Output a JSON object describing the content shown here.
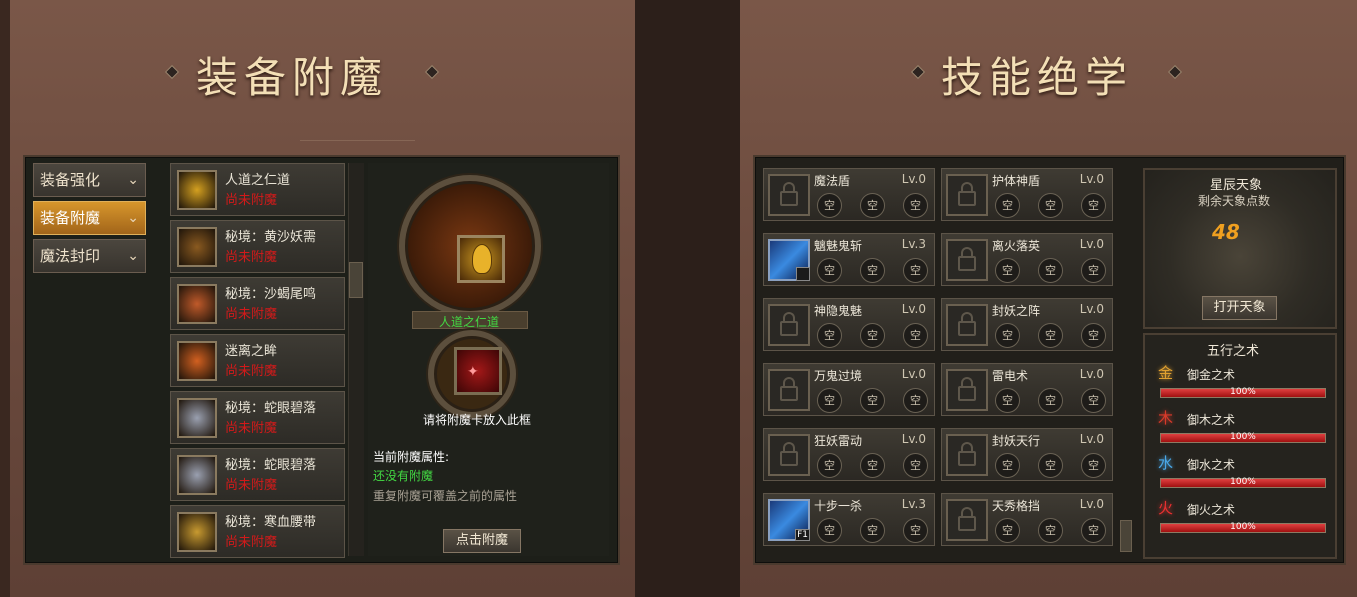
{
  "left_panel": {
    "title": "装备附魔",
    "tabs": [
      {
        "label": "装备强化",
        "active": false
      },
      {
        "label": "装备附魔",
        "active": true
      },
      {
        "label": "魔法封印",
        "active": false
      }
    ],
    "items": [
      {
        "name": "人道之仁道",
        "status": "尚未附魔"
      },
      {
        "name": "秘境：黄沙妖需",
        "status": "尚未附魔"
      },
      {
        "name": "秘境：沙蝎尾鸣",
        "status": "尚未附魔"
      },
      {
        "name": "迷离之眸",
        "status": "尚未附魔"
      },
      {
        "name": "秘境：蛇眼碧落",
        "status": "尚未附魔"
      },
      {
        "name": "秘境：蛇眼碧落",
        "status": "尚未附魔"
      },
      {
        "name": "秘境：寒血腰带",
        "status": "尚未附魔"
      }
    ],
    "enchant": {
      "selected_item": "人道之仁道",
      "slot_hint": "请将附魔卡放入此框",
      "attr_label": "当前附魔属性:",
      "attr_value": "还没有附魔",
      "attr_note": "重复附魔可覆盖之前的属性",
      "button": "点击附魔"
    }
  },
  "right_panel": {
    "title": "技能绝学",
    "empty_label": "空",
    "skills": [
      {
        "name": "魔法盾",
        "level": "Lv.0",
        "locked": true
      },
      {
        "name": "护体神盾",
        "level": "Lv.0",
        "locked": true
      },
      {
        "name": "魑魅鬼斩",
        "level": "Lv.3",
        "locked": false
      },
      {
        "name": "离火落英",
        "level": "Lv.0",
        "locked": true
      },
      {
        "name": "神隐鬼魅",
        "level": "Lv.0",
        "locked": true
      },
      {
        "name": "封妖之阵",
        "level": "Lv.0",
        "locked": true
      },
      {
        "name": "万鬼过境",
        "level": "Lv.0",
        "locked": true
      },
      {
        "name": "雷电术",
        "level": "Lv.0",
        "locked": true
      },
      {
        "name": "狂妖雷动",
        "level": "Lv.0",
        "locked": true
      },
      {
        "name": "封妖天行",
        "level": "Lv.0",
        "locked": true
      },
      {
        "name": "十步一杀",
        "level": "Lv.3",
        "locked": false,
        "hotkey": "F1"
      },
      {
        "name": "天秀格挡",
        "level": "Lv.0",
        "locked": true
      }
    ],
    "star": {
      "title": "星辰天象",
      "subtitle": "剩余天象点数",
      "points": "48",
      "button": "打开天象"
    },
    "wuxing": {
      "title": "五行之术",
      "items": [
        {
          "glyph": "金",
          "name": "御金之术",
          "percent": "100%",
          "value": 1.0,
          "color": "#e0a030"
        },
        {
          "glyph": "木",
          "name": "御木之术",
          "percent": "100%",
          "value": 1.0,
          "color": "#d83a2a"
        },
        {
          "glyph": "水",
          "name": "御水之术",
          "percent": "100%",
          "value": 1.0,
          "color": "#4aa8e8"
        },
        {
          "glyph": "火",
          "name": "御火之术",
          "percent": "100%",
          "value": 1.0,
          "color": "#e83030"
        }
      ]
    }
  }
}
